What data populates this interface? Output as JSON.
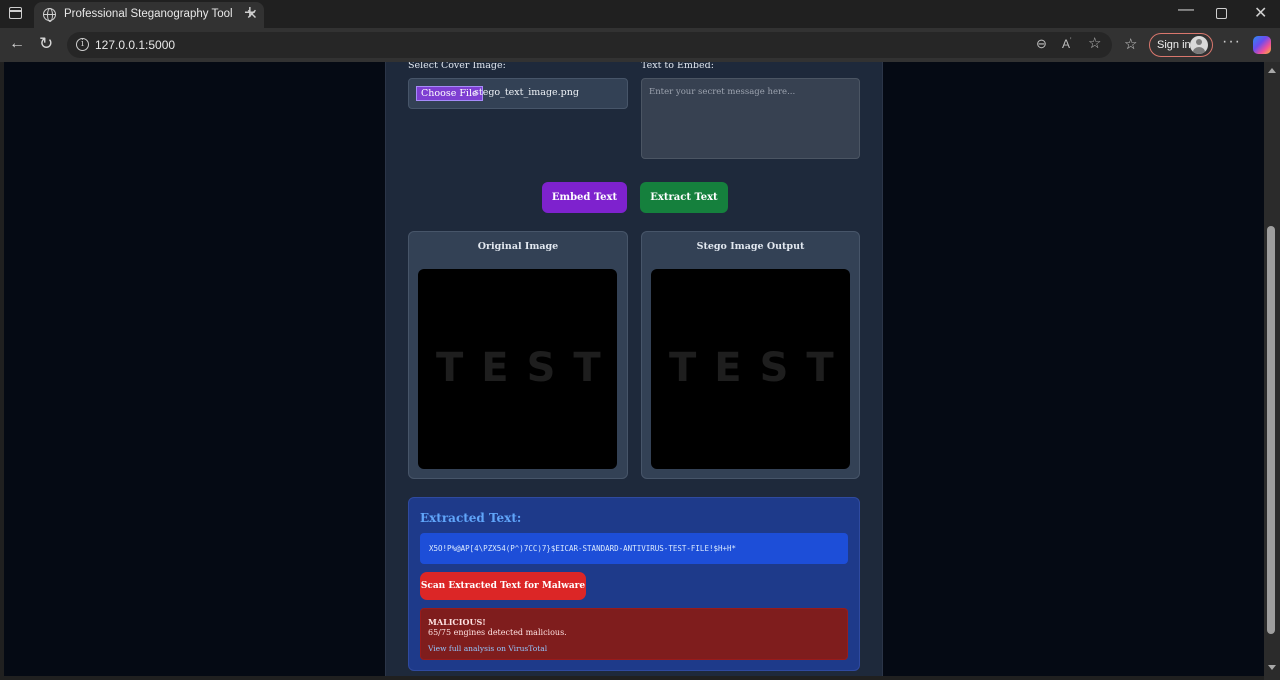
{
  "browser": {
    "tab_title": "Professional Steganography Tool",
    "url": "127.0.0.1:5000",
    "sign_in_label": "Sign in",
    "icons": [
      "window-menu-icon",
      "globe-icon",
      "close-icon",
      "plus-icon",
      "minimize-icon",
      "maximize-icon",
      "back-arrow-icon",
      "reload-icon",
      "info-icon",
      "zoom-out-icon",
      "read-aloud-icon",
      "favorite-star-icon",
      "favorites-icon",
      "more-icon",
      "copilot-icon"
    ]
  },
  "form": {
    "cover_label": "Select Cover Image:",
    "choose_file_label": "Choose File",
    "file_name": "stego_text_image.png",
    "text_label": "Text to Embed:",
    "text_placeholder": "Enter your secret message here..."
  },
  "actions": {
    "embed_label": "Embed Text",
    "extract_label": "Extract Text"
  },
  "images": {
    "original_title": "Original Image",
    "stego_title": "Stego Image Output",
    "image_text": "TEST"
  },
  "extraction": {
    "title": "Extracted Text:",
    "text": "X5O!P%@AP[4\\PZX54(P^)7CC)7}$EICAR-STANDARD-ANTIVIRUS-TEST-FILE!$H+H*",
    "scan_label": "Scan Extracted Text for Malware",
    "result_status": "MALICIOUS!",
    "result_detail": "65/75 engines detected malicious.",
    "result_link": "View full analysis on VirusTotal"
  },
  "colors": {
    "embed_button": "#7e22ce",
    "extract_button": "#15803d",
    "scan_button": "#dc2626",
    "malicious_bg": "#7f1d1d",
    "panel_bg": "#1e3a8a"
  }
}
